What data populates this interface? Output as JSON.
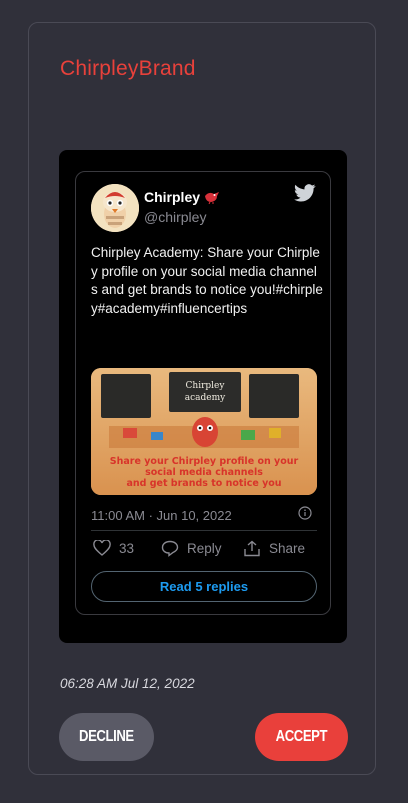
{
  "brand": {
    "name": "ChirpleyBrand",
    "color": "#e8413b"
  },
  "tweet": {
    "display_name": "Chirpley",
    "handle": "@chirpley",
    "badge_icon": "red-bird-emoji",
    "platform_icon": "twitter-icon",
    "text": "Chirpley Academy: Share your Chirpley profile on your social media channels and get brands to notice you!#chirpley#academy#influencertips",
    "media": {
      "board_text": "Chirpley academy",
      "caption": "Share your Chirpley profile on your social media channels and get brands to notice you"
    },
    "timestamp": "11:00 AM · Jun 10, 2022",
    "likes": "33",
    "reply_label": "Reply",
    "share_label": "Share",
    "read_replies_label": "Read 5 replies"
  },
  "post_date": "06:28 AM Jul 12, 2022",
  "buttons": {
    "decline": "DECLINE",
    "accept": "ACCEPT"
  },
  "colors": {
    "background": "#30303a",
    "accept": "#e9403b",
    "decline": "#5a5a66",
    "link": "#1d9bf0"
  }
}
